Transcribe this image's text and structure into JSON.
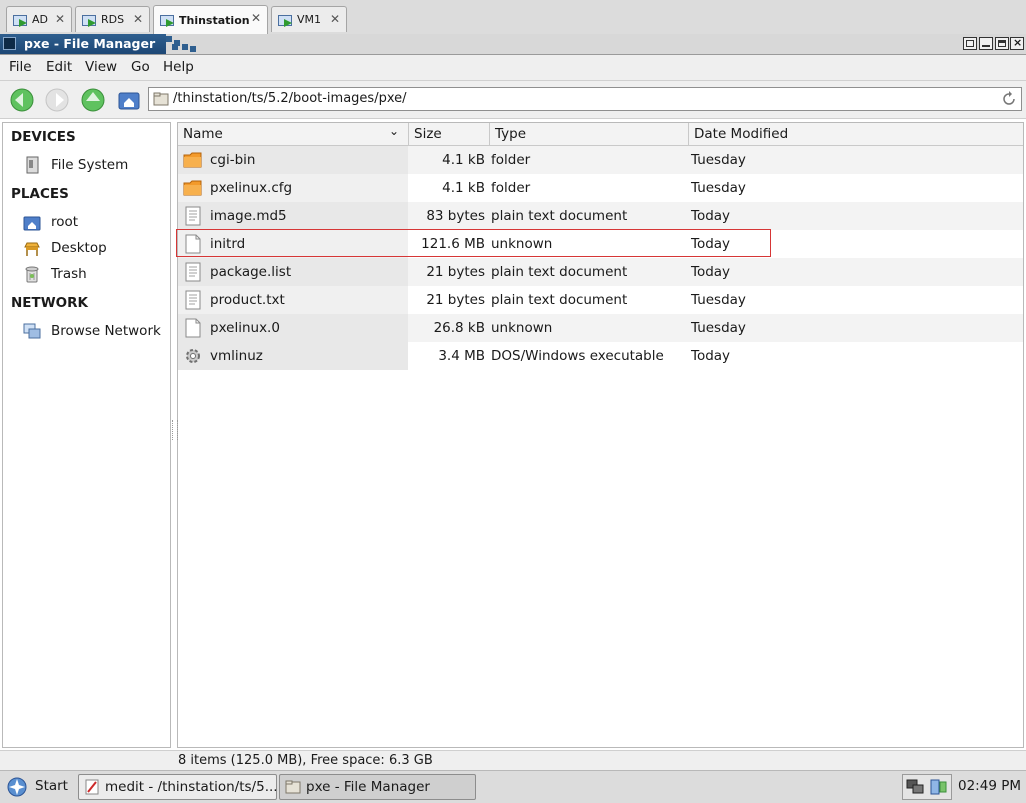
{
  "tabs": [
    {
      "label": "AD"
    },
    {
      "label": "RDS"
    },
    {
      "label": "Thinstation",
      "active": true
    },
    {
      "label": "VM1"
    }
  ],
  "window": {
    "title": "pxe - File Manager"
  },
  "menu": [
    "File",
    "Edit",
    "View",
    "Go",
    "Help"
  ],
  "toolbar": {
    "location": "/thinstation/ts/5.2/boot-images/pxe/"
  },
  "sidebar": {
    "devices_heading": "DEVICES",
    "devices": [
      {
        "label": "File System",
        "icon": "drive-icon"
      }
    ],
    "places_heading": "PLACES",
    "places": [
      {
        "label": "root",
        "icon": "home-folder-icon"
      },
      {
        "label": "Desktop",
        "icon": "desktop-icon"
      },
      {
        "label": "Trash",
        "icon": "trash-icon"
      }
    ],
    "network_heading": "NETWORK",
    "network": [
      {
        "label": "Browse Network",
        "icon": "network-icon"
      }
    ]
  },
  "columns": {
    "name": "Name",
    "size": "Size",
    "type": "Type",
    "date": "Date Modified"
  },
  "files": [
    {
      "name": "cgi-bin",
      "size": "4.1 kB",
      "type": "folder",
      "date": "Tuesday",
      "icon": "folder-icon"
    },
    {
      "name": "pxelinux.cfg",
      "size": "4.1 kB",
      "type": "folder",
      "date": "Tuesday",
      "icon": "folder-icon"
    },
    {
      "name": "image.md5",
      "size": "83 bytes",
      "type": "plain text document",
      "date": "Today",
      "icon": "text-file-icon"
    },
    {
      "name": "initrd",
      "size": "121.6 MB",
      "type": "unknown",
      "date": "Today",
      "icon": "blank-file-icon"
    },
    {
      "name": "package.list",
      "size": "21 bytes",
      "type": "plain text document",
      "date": "Today",
      "icon": "text-file-icon"
    },
    {
      "name": "product.txt",
      "size": "21 bytes",
      "type": "plain text document",
      "date": "Tuesday",
      "icon": "text-file-icon"
    },
    {
      "name": "pxelinux.0",
      "size": "26.8 kB",
      "type": "unknown",
      "date": "Tuesday",
      "icon": "blank-file-icon"
    },
    {
      "name": "vmlinuz",
      "size": "3.4 MB",
      "type": "DOS/Windows executable",
      "date": "Today",
      "icon": "executable-gear-icon"
    }
  ],
  "status": "8 items (125.0 MB), Free space: 6.3 GB",
  "taskbar": {
    "start": "Start",
    "tasks": [
      {
        "label": "medit - /thinstation/ts/5...."
      },
      {
        "label": "pxe - File Manager",
        "active": true
      }
    ],
    "clock": "02:49 PM"
  },
  "colors": {
    "title_blue": "#2f5f8f",
    "highlight_red": "#d63636"
  }
}
